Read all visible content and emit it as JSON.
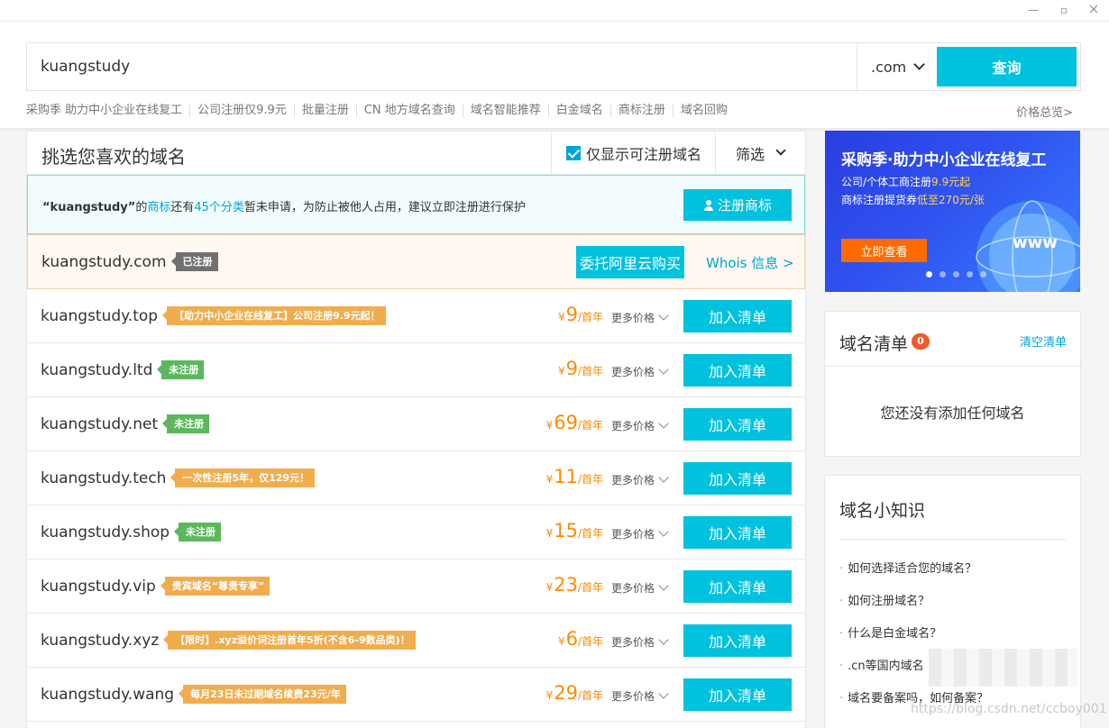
{
  "window": {
    "minimize": "—",
    "maximize": "▫"
  },
  "search": {
    "value": "kuangstudy",
    "suffix": ".com",
    "button": "查询"
  },
  "quick_links": [
    "采购季 助力中小企业在线复工",
    "公司注册仅9.9元",
    "批量注册",
    "CN 地方域名查询",
    "域名智能推荐",
    "白金域名",
    "商标注册",
    "域名回购"
  ],
  "price_overview": "价格总览>",
  "main": {
    "title": "挑选您喜欢的域名",
    "only_available": "仅显示可注册域名",
    "filter": "筛选"
  },
  "trademark": {
    "prefix": "“kuangstudy”",
    "t1": "的",
    "link1": "商标",
    "t2": "还有",
    "link2": "45个分类",
    "t3": "暂未申请，为防止被他人占用，建议立即注册进行保护",
    "button": "注册商标"
  },
  "registered": {
    "name": "kuangstudy.com",
    "tag": "已注册",
    "agent_button": "委托阿里云购买",
    "whois": "Whois 信息 >"
  },
  "domains": [
    {
      "name": "kuangstudy.top",
      "tag": "【助力中小企业在线复工】公司注册9.9元起！",
      "tag_color": "orange",
      "currency": "¥",
      "price": "9",
      "unit": "/首年",
      "more": "更多价格",
      "button": "加入清单"
    },
    {
      "name": "kuangstudy.ltd",
      "tag": "未注册",
      "tag_color": "green",
      "currency": "¥",
      "price": "9",
      "unit": "/首年",
      "more": "更多价格",
      "button": "加入清单"
    },
    {
      "name": "kuangstudy.net",
      "tag": "未注册",
      "tag_color": "green",
      "currency": "¥",
      "price": "69",
      "unit": "/首年",
      "more": "更多价格",
      "button": "加入清单"
    },
    {
      "name": "kuangstudy.tech",
      "tag": "一次性注册5年，仅129元！",
      "tag_color": "orange",
      "currency": "¥",
      "price": "11",
      "unit": "/首年",
      "more": "更多价格",
      "button": "加入清单"
    },
    {
      "name": "kuangstudy.shop",
      "tag": "未注册",
      "tag_color": "green",
      "currency": "¥",
      "price": "15",
      "unit": "/首年",
      "more": "更多价格",
      "button": "加入清单"
    },
    {
      "name": "kuangstudy.vip",
      "tag": "贵宾域名“尊贵专享”",
      "tag_color": "orange",
      "currency": "¥",
      "price": "23",
      "unit": "/首年",
      "more": "更多价格",
      "button": "加入清单"
    },
    {
      "name": "kuangstudy.xyz",
      "tag": "【限时】.xyz溢价词注册首年5折(不含6-9数品类)！",
      "tag_color": "orange",
      "currency": "¥",
      "price": "6",
      "unit": "/首年",
      "more": "更多价格",
      "button": "加入清单"
    },
    {
      "name": "kuangstudy.wang",
      "tag": "每月23日未过期域名续费23元/年",
      "tag_color": "orange",
      "currency": "¥",
      "price": "29",
      "unit": "/首年",
      "more": "更多价格",
      "button": "加入清单"
    }
  ],
  "banner": {
    "title": "采购季·助力中小企业在线复工",
    "line1_a": "公司/个体工商注册",
    "line1_b": "9.9元起",
    "line2_a": "商标注册提货券",
    "line2_b": "低至270元/张",
    "button": "立即查看",
    "globe_text": "www"
  },
  "cart": {
    "title": "域名清单",
    "count": "0",
    "clear": "清空清单",
    "empty": "您还没有添加任何域名"
  },
  "tips": {
    "title": "域名小知识",
    "items": [
      "如何选择适合您的域名？",
      "如何注册域名？",
      "什么是白金域名？",
      ".cn等国内域名",
      "域名要备案吗，如何备案？"
    ]
  },
  "watermark": "https://blog.csdn.net/ccboy001",
  "colors": {
    "accent": "#00c1de",
    "price": "#ff8a00",
    "link": "#00a4d8",
    "badge": "#f05a28"
  }
}
